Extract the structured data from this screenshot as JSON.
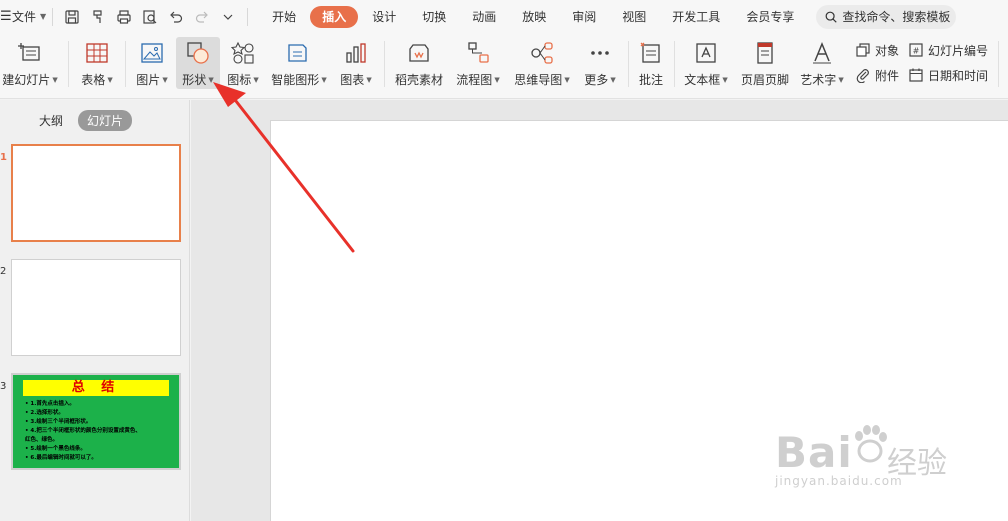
{
  "menubar": {
    "file_label": "文件",
    "tabs": [
      "开始",
      "插入",
      "设计",
      "切换",
      "动画",
      "放映",
      "审阅",
      "视图",
      "开发工具",
      "会员专享"
    ],
    "search_placeholder": "查找命令、搜索模板"
  },
  "ribbon": {
    "new_slide": "建幻灯片",
    "table": "表格",
    "picture": "图片",
    "shape": "形状",
    "icon": "图标",
    "smartart": "智能图形",
    "chart": "图表",
    "docer": "稻壳素材",
    "flowchart": "流程图",
    "mindmap": "思维导图",
    "more": "更多",
    "comment": "批注",
    "textbox": "文本框",
    "header_footer": "页眉页脚",
    "wordart": "艺术字",
    "object": "对象",
    "attachment": "附件",
    "slide_number": "幻灯片编号",
    "date_time": "日期和时间"
  },
  "panel": {
    "outline_tab": "大纲",
    "slides_tab": "幻灯片",
    "slide_numbers": [
      "1",
      "2",
      "3"
    ],
    "thumb3_title": "总 结",
    "thumb3_lines": [
      "• 1.首先点击插入。",
      "• 2.选择形状。",
      "• 3.绘制三个半闭框形状。",
      "• 4.把三个半闭框形状的颜色分别设置成黄色、",
      "    红色、绿色。",
      "• 5.绘制一个黑色线条。",
      "• 6.最后编辑时间就可以了。"
    ]
  },
  "watermark": {
    "brand": "Bai",
    "brand2": "经验",
    "url": "jingyan.baidu.com"
  },
  "colors": {
    "accent": "#e8704a",
    "thumb3_bg": "#1cb14a",
    "thumb3_title_bg": "#ffff00",
    "thumb3_title_fg": "#e00000",
    "arrow": "#e8312a"
  }
}
